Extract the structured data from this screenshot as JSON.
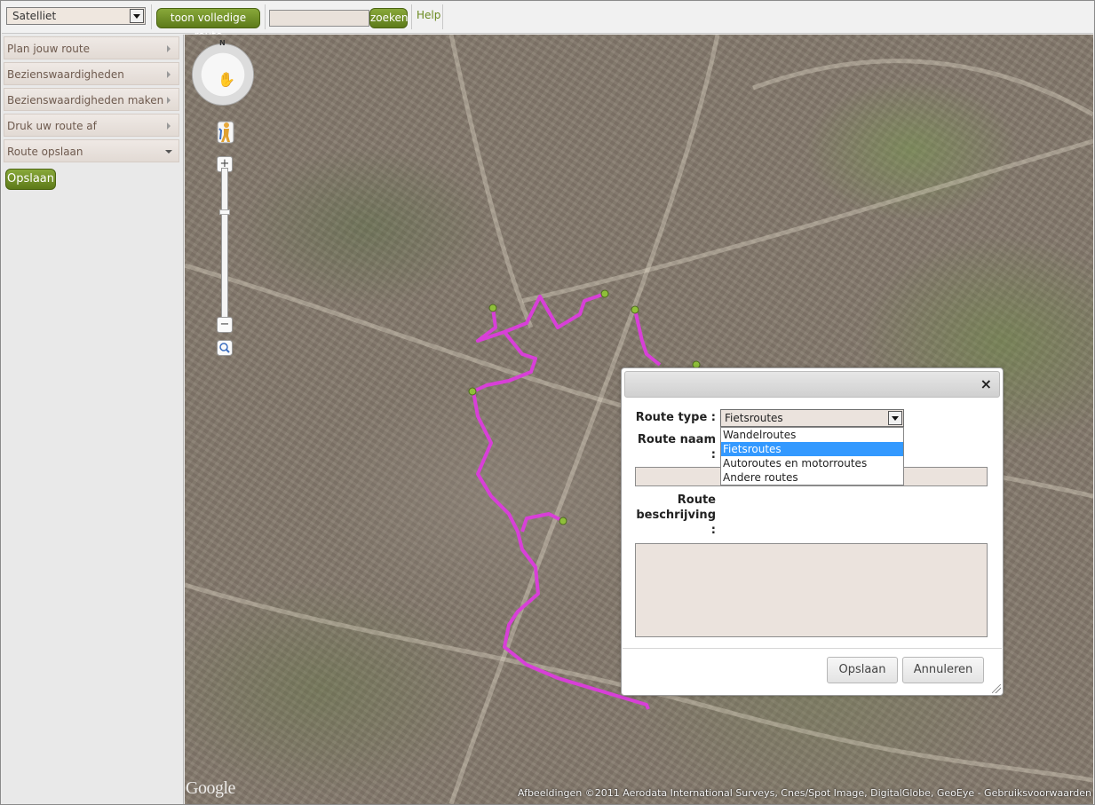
{
  "toolbar": {
    "map_type_value": "Satelliet",
    "show_route_button": "toon volledige route",
    "search_value": "",
    "search_button": "zoeken",
    "help_link": "Help"
  },
  "sidebar": {
    "items": [
      {
        "label": "Plan jouw route",
        "state": "collapsed"
      },
      {
        "label": "Bezienswaardigheden",
        "state": "collapsed"
      },
      {
        "label": "Bezienswaardigheden maken",
        "state": "collapsed"
      },
      {
        "label": "Druk uw route af",
        "state": "collapsed"
      },
      {
        "label": "Route opslaan",
        "state": "expanded"
      }
    ],
    "save_button": "Opslaan"
  },
  "map": {
    "compass_label": "N",
    "zoom_in": "+",
    "zoom_out": "−",
    "logo": "Google",
    "attribution": "Afbeeldingen ©2011 Aerodata International Surveys, Cnes/Spot Image, DigitalGlobe, GeoEye - Gebruiksvoorwaarden",
    "route_color": "#d83fd8",
    "waypoint_color": "#8fbf3a"
  },
  "dialog": {
    "close_symbol": "×",
    "route_type_label": "Route type :",
    "route_type_value": "Fietsroutes",
    "route_type_options": [
      "Wandelroutes",
      "Fietsroutes",
      "Autoroutes en motorroutes",
      "Andere routes"
    ],
    "route_type_selected_index": 1,
    "route_name_label_line1": "Route naam",
    "route_name_label_line2": ":",
    "route_name_value": "",
    "route_desc_label_line1": "Route",
    "route_desc_label_line2": "beschrijving",
    "route_desc_label_line3": ":",
    "route_desc_value": "",
    "save_button": "Opslaan",
    "cancel_button": "Annuleren"
  },
  "colors": {
    "accent_green": "#6c8a21",
    "selected_option": "#3399ff"
  }
}
